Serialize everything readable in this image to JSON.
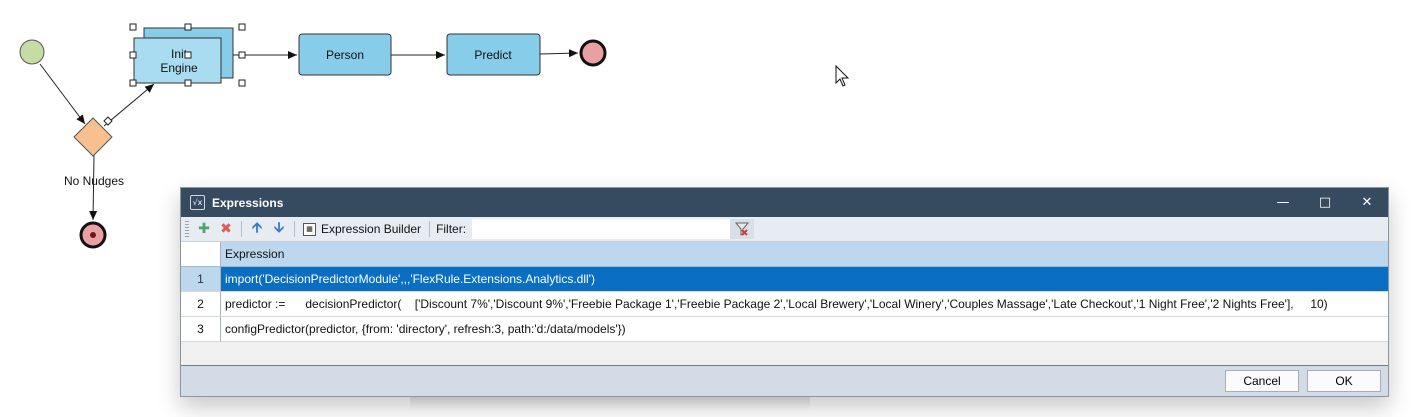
{
  "diagram": {
    "nodes": {
      "init_engine": "Init\nEngine",
      "person": "Person",
      "predict": "Predict",
      "gateway_label": "No Nudges"
    }
  },
  "dialog": {
    "title": "Expressions",
    "icon": "expression-icon",
    "toolbar": {
      "add_icon": "plus-icon",
      "delete_icon": "x-icon",
      "up_icon": "arrow-up-icon",
      "down_icon": "arrow-down-icon",
      "expression_builder_label": "Expression Builder",
      "filter_label": "Filter:",
      "filter_value": ""
    },
    "grid": {
      "column_header": "Expression",
      "rows": [
        {
          "num": "1",
          "expression": "import('DecisionPredictorModule',,,'FlexRule.Extensions.Analytics.dll')"
        },
        {
          "num": "2",
          "expression": "predictor :=      decisionPredictor(    ['Discount 7%','Discount 9%','Freebie Package 1','Freebie Package 2','Local Brewery','Local Winery','Couples Massage','Late Checkout','1 Night Free','2 Nights Free'],     10)"
        },
        {
          "num": "3",
          "expression": "configPredictor(predictor, {from: 'directory', refresh:3, path:'d:/data/models'})"
        }
      ]
    },
    "buttons": {
      "cancel": "Cancel",
      "ok": "OK"
    }
  },
  "colors": {
    "titlebar": "#364b60",
    "selection": "#0a6fc2",
    "task_fill": "#87cce8",
    "start_event": "#c5dda2",
    "end_event": "#e8a0a0",
    "gateway": "#f9c08f"
  }
}
